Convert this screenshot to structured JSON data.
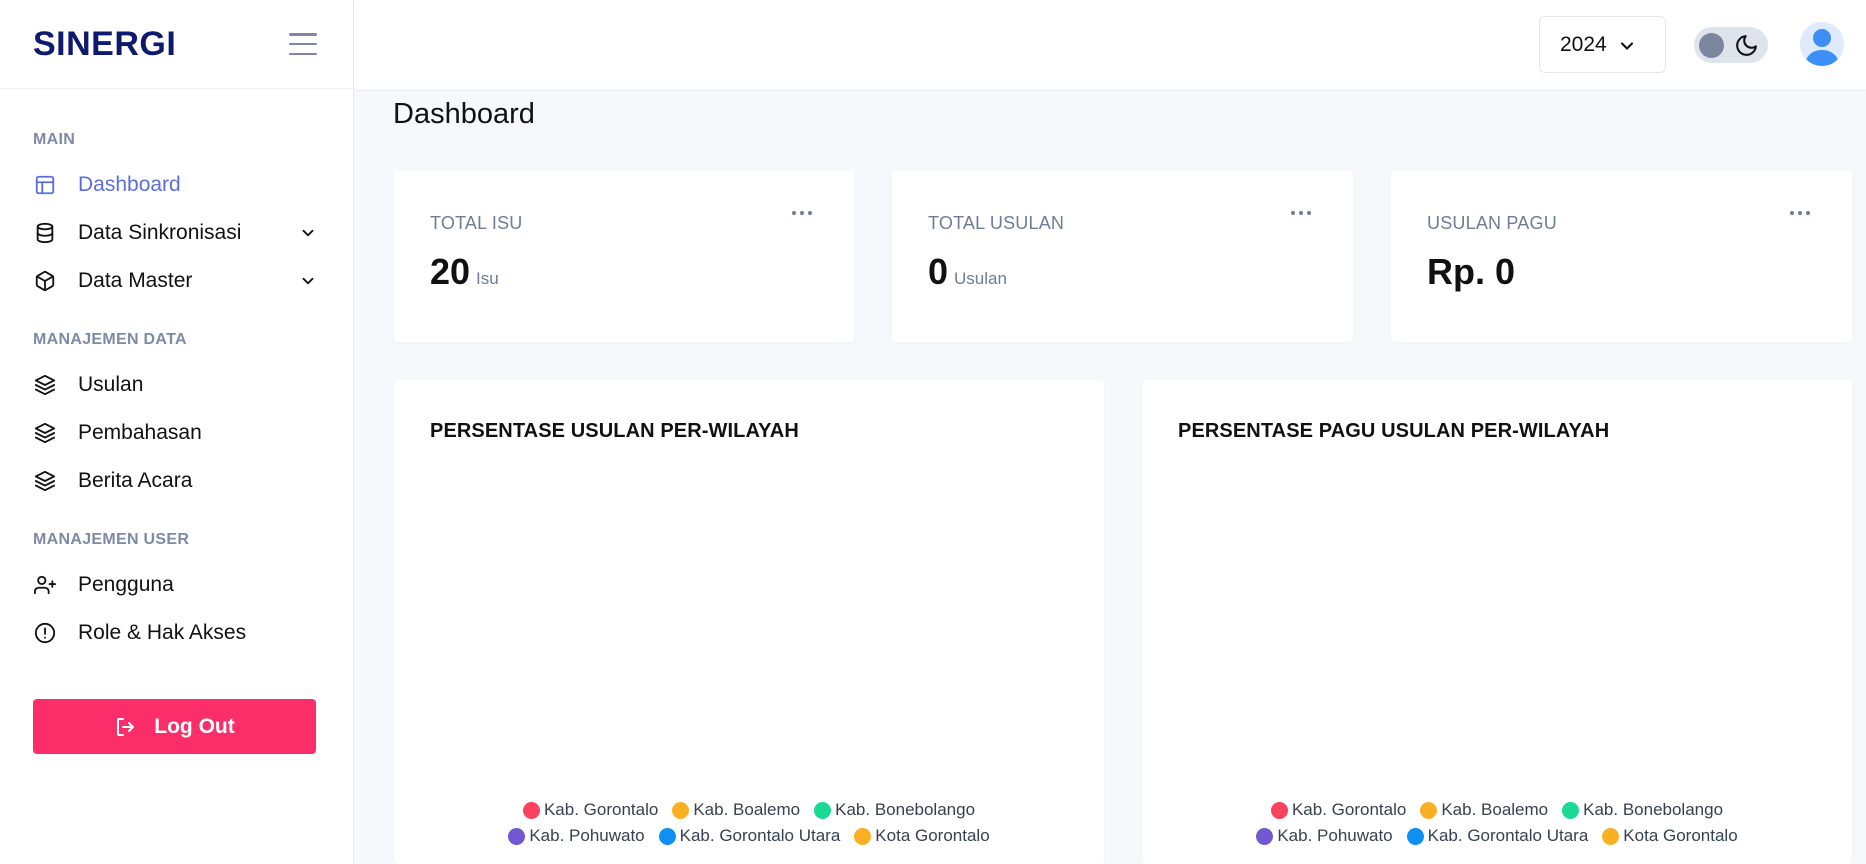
{
  "brand": "SINERGI",
  "sidebar": {
    "sections": [
      {
        "title": "MAIN",
        "items": [
          {
            "label": "Dashboard",
            "icon": "layout-icon",
            "active": true
          },
          {
            "label": "Data Sinkronisasi",
            "icon": "database-icon",
            "has_submenu": true
          },
          {
            "label": "Data Master",
            "icon": "box-icon",
            "has_submenu": true
          }
        ]
      },
      {
        "title": "MANAJEMEN DATA",
        "items": [
          {
            "label": "Usulan",
            "icon": "layers-icon"
          },
          {
            "label": "Pembahasan",
            "icon": "layers-icon"
          },
          {
            "label": "Berita Acara",
            "icon": "layers-icon"
          }
        ]
      },
      {
        "title": "MANAJEMEN USER",
        "items": [
          {
            "label": "Pengguna",
            "icon": "user-plus-icon"
          },
          {
            "label": "Role & Hak Akses",
            "icon": "alert-circle-icon"
          }
        ]
      }
    ],
    "logout_label": "Log Out"
  },
  "topbar": {
    "year": "2024"
  },
  "page_title": "Dashboard",
  "stats": [
    {
      "label": "TOTAL ISU",
      "value": "20",
      "unit": "Isu"
    },
    {
      "label": "TOTAL USULAN",
      "value": "0",
      "unit": "Usulan"
    },
    {
      "label": "USULAN PAGU",
      "value": "Rp. 0",
      "unit": ""
    }
  ],
  "charts": [
    {
      "title": "PERSENTASE USULAN PER-WILAYAH",
      "legend": [
        {
          "label": "Kab. Gorontalo",
          "color": "#f8425e"
        },
        {
          "label": "Kab. Boalemo",
          "color": "#fbb024"
        },
        {
          "label": "Kab. Bonebolango",
          "color": "#19d995"
        },
        {
          "label": "Kab. Pohuwato",
          "color": "#7359d1"
        },
        {
          "label": "Kab. Gorontalo Utara",
          "color": "#0f8ff1"
        },
        {
          "label": "Kota Gorontalo",
          "color": "#fbb024"
        }
      ]
    },
    {
      "title": "PERSENTASE PAGU USULAN PER-WILAYAH",
      "legend": [
        {
          "label": "Kab. Gorontalo",
          "color": "#f8425e"
        },
        {
          "label": "Kab. Boalemo",
          "color": "#fbb024"
        },
        {
          "label": "Kab. Bonebolango",
          "color": "#19d995"
        },
        {
          "label": "Kab. Pohuwato",
          "color": "#7359d1"
        },
        {
          "label": "Kab. Gorontalo Utara",
          "color": "#0f8ff1"
        },
        {
          "label": "Kota Gorontalo",
          "color": "#fbb024"
        }
      ]
    }
  ]
}
